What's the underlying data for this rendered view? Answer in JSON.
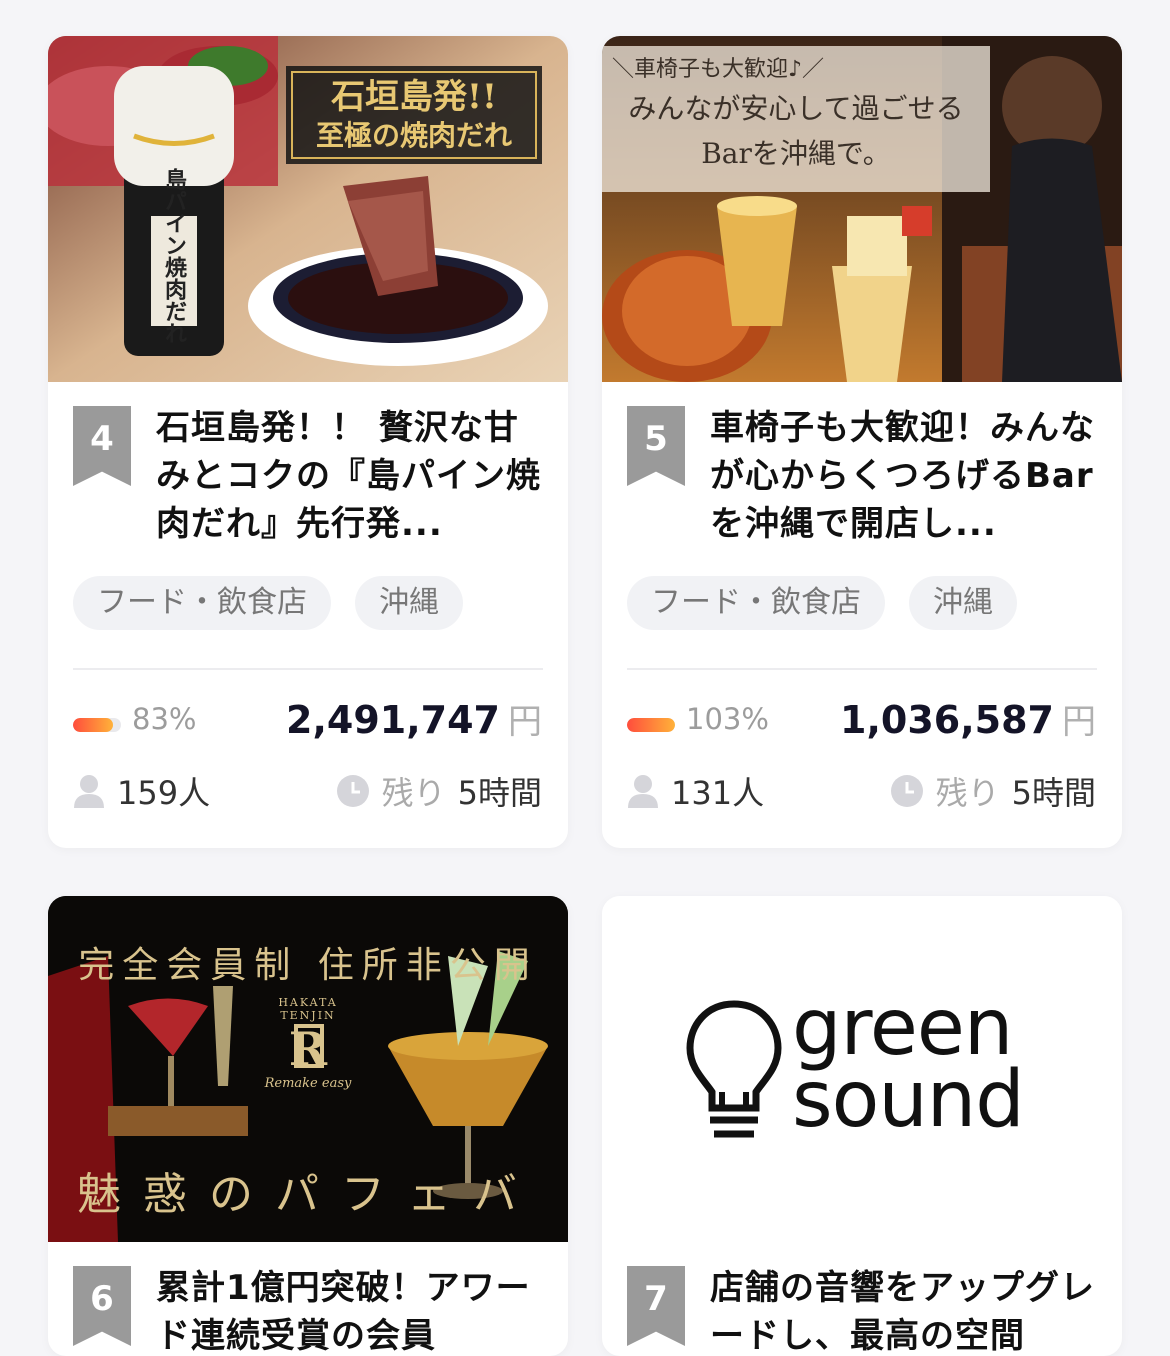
{
  "cards": [
    {
      "rank": "4",
      "image_text": [
        "石垣島発!!",
        "至極の焼肉だれ"
      ],
      "bottle_text": "島パイン焼肉だれ",
      "title": "石垣島発！！ 贅沢な甘みとコクの『島パイン焼肉だれ』先行発...",
      "tags": [
        "フード・飲食店",
        "沖縄"
      ],
      "percent": "83%",
      "progress": 0.83,
      "amount": "2,491,747",
      "currency": "円",
      "supporters": "159人",
      "remain_label": "残り",
      "remain_value": "5時間"
    },
    {
      "rank": "5",
      "image_text": [
        "＼車椅子も大歓迎♪／",
        "みんなが安心して過ごせる",
        "Barを沖縄で。"
      ],
      "title": "車椅子も大歓迎！みんなが心からくつろげるBarを沖縄で開店し...",
      "tags": [
        "フード・飲食店",
        "沖縄"
      ],
      "percent": "103%",
      "progress": 1.0,
      "amount": "1,036,587",
      "currency": "円",
      "supporters": "131人",
      "remain_label": "残り",
      "remain_value": "5時間"
    },
    {
      "rank": "6",
      "image_text": [
        "完全会員制 住所非公開",
        "魅惑のパフェバー",
        "HAKATA TENJIN",
        "R",
        "Remake easy"
      ],
      "title": "累計1億円突破！アワード連続受賞の会員"
    },
    {
      "rank": "7",
      "logo_text": [
        "green",
        "sound"
      ],
      "title": "店舗の音響をアップグレードし、最高の空間"
    }
  ],
  "colors": {
    "rank_badge": "#9a9a9a",
    "progress_start": "#ff4d3c",
    "progress_end": "#ffb23a",
    "tag_bg": "#f1f2f5"
  },
  "icons": [
    "person-icon",
    "clock-icon",
    "lightbulb-icon"
  ]
}
